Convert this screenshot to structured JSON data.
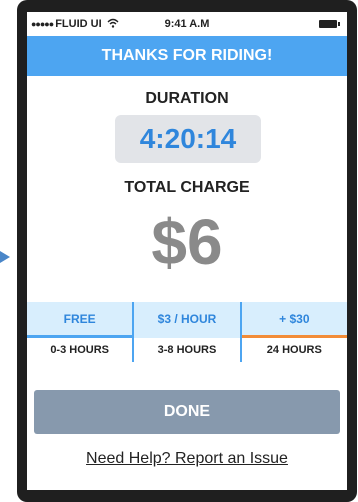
{
  "status_bar": {
    "signal": "●●●●●",
    "carrier": "FLUID UI",
    "wifi_icon": "wifi-icon",
    "time": "9:41 A.M",
    "battery_icon": "battery-icon"
  },
  "header": {
    "title": "THANKS FOR RIDING!"
  },
  "duration": {
    "label": "DURATION",
    "value": "4:20:14"
  },
  "charge": {
    "label": "TOTAL CHARGE",
    "value": "$6"
  },
  "plans": [
    {
      "name": "FREE",
      "range": "0-3 HOURS",
      "bar_color": "#4da5f1"
    },
    {
      "name": "$3 / HOUR",
      "range": "3-8 HOURS",
      "bar_color": "#d8eefd"
    },
    {
      "name": "+ $30",
      "range": "24 HOURS",
      "bar_color": "#f28c38"
    }
  ],
  "actions": {
    "done_label": "DONE",
    "help_link": "Need Help? Report an Issue"
  },
  "colors": {
    "accent": "#4da5f1",
    "duration_text": "#2f86dc",
    "done_button": "#8799ad",
    "charge_text": "#8a8a8a"
  }
}
